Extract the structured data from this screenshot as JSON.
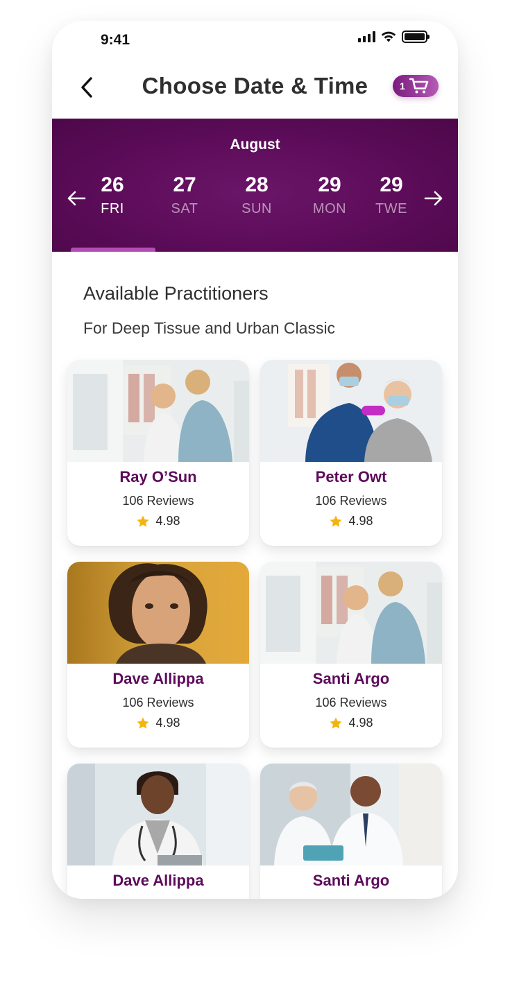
{
  "status_bar": {
    "time": "9:41"
  },
  "header": {
    "title": "Choose Date & Time",
    "cart_count": "1"
  },
  "calendar": {
    "month": "August",
    "days": [
      {
        "num": "26",
        "name": "FRI",
        "active": true
      },
      {
        "num": "27",
        "name": "SAT",
        "active": false
      },
      {
        "num": "28",
        "name": "SUN",
        "active": false
      },
      {
        "num": "29",
        "name": "MON",
        "active": false
      },
      {
        "num": "29",
        "name": "TWE",
        "active": false
      }
    ]
  },
  "section": {
    "title": "Available Practitioners",
    "subtitle": "For Deep Tissue and Urban Classic"
  },
  "practitioners": [
    {
      "name": "Ray O’Sun",
      "reviews": "106 Reviews",
      "rating": "4.98",
      "photo": "therapist-shoulder"
    },
    {
      "name": "Peter Owt",
      "reviews": "106 Reviews",
      "rating": "4.98",
      "photo": "therapist-dumbbell"
    },
    {
      "name": "Dave Allippa",
      "reviews": "106 Reviews",
      "rating": "4.98",
      "photo": "portrait-woman"
    },
    {
      "name": "Santi Argo",
      "reviews": "106 Reviews",
      "rating": "4.98",
      "photo": "therapist-shoulder"
    },
    {
      "name": "Dave Allippa",
      "reviews": "",
      "rating": "",
      "photo": "doctor-tablet"
    },
    {
      "name": "Santi Argo",
      "reviews": "",
      "rating": "",
      "photo": "doctors-pair"
    }
  ],
  "colors": {
    "brand": "#5a0b57",
    "name": "#5d0b5b",
    "accent": "#b24db3",
    "star": "#f5b40b"
  }
}
